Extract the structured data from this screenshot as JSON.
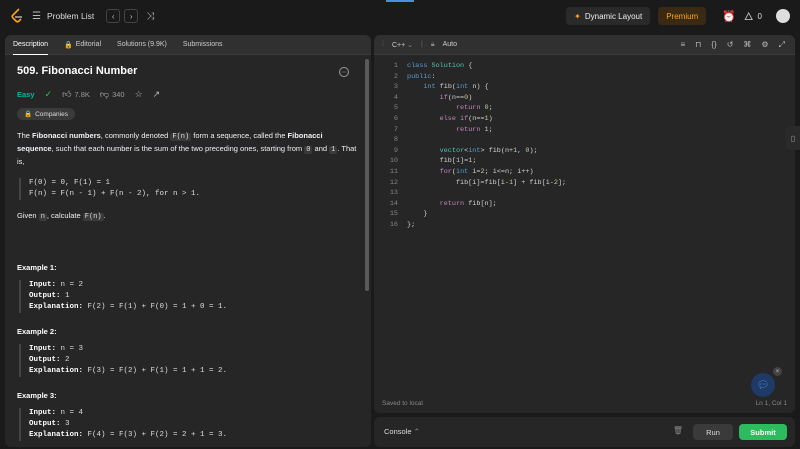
{
  "topbar": {
    "problem_list": "Problem List",
    "dynamic_layout": "Dynamic Layout",
    "premium": "Premium",
    "fire_count": "0"
  },
  "tabs": {
    "description": "Description",
    "editorial": "Editorial",
    "solutions": "Solutions (9.9K)",
    "submissions": "Submissions"
  },
  "problem": {
    "title": "509. Fibonacci Number",
    "difficulty": "Easy",
    "likes": "7.8K",
    "dislikes": "340",
    "companies": "Companies",
    "p1_a": "The ",
    "p1_b": "Fibonacci numbers",
    "p1_c": ", commonly denoted ",
    "p1_code1": "F(n)",
    "p1_d": " form a sequence, called the ",
    "p1_e": "Fibonacci sequence",
    "p1_f": ", such that each number is the sum of the two preceding ones, starting from ",
    "p1_code2": "0",
    "p1_g": " and ",
    "p1_code3": "1",
    "p1_h": ". That is,",
    "formula_1": "F(0) = 0, F(1) = 1",
    "formula_2": "F(n) = F(n - 1) + F(n - 2), for n > 1.",
    "given_a": "Given ",
    "given_code1": "n",
    "given_b": ", calculate ",
    "given_code2": "F(n)",
    "given_c": "."
  },
  "examples": [
    {
      "title": "Example 1:",
      "input": "n = 2",
      "output": "1",
      "explanation": "F(2) = F(1) + F(0) = 1 + 0 = 1."
    },
    {
      "title": "Example 2:",
      "input": "n = 3",
      "output": "2",
      "explanation": "F(3) = F(2) + F(1) = 1 + 1 = 2."
    },
    {
      "title": "Example 3:",
      "input": "n = 4",
      "output": "3",
      "explanation": "F(4) = F(3) + F(2) = 2 + 1 = 3."
    }
  ],
  "labels": {
    "input": "Input:",
    "output": "Output:",
    "explanation": "Explanation:"
  },
  "editor": {
    "language": "C++",
    "mode": "Auto",
    "saved": "Saved to local",
    "cursor": "Ln 1, Col 1"
  },
  "console": {
    "label": "Console",
    "run": "Run",
    "submit": "Submit"
  },
  "colors": {
    "accent": "#ffa116",
    "easy": "#00b8a3",
    "submit": "#2cbb5d"
  }
}
